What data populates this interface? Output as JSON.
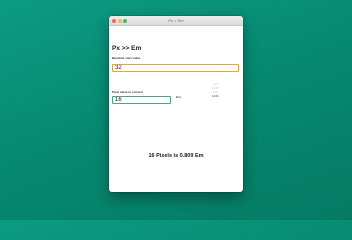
{
  "window": {
    "title": "Px > Em"
  },
  "app": {
    "heading": "Px >> Em",
    "base_label": "Baseline start value",
    "base_value": "32",
    "px_label": "Pixel value to convert",
    "px_value": "16",
    "unit_label": "Ems",
    "picker_options": [
      "1.0",
      "1.125",
      "1.25",
      "1.0/16"
    ],
    "picker_selected_index": 3,
    "result": "16 Pixels is 0.809 Em"
  },
  "colors": {
    "desktop": "#0a917a",
    "focus_ring": "#f0a044",
    "field_border": "#4aa58a"
  }
}
